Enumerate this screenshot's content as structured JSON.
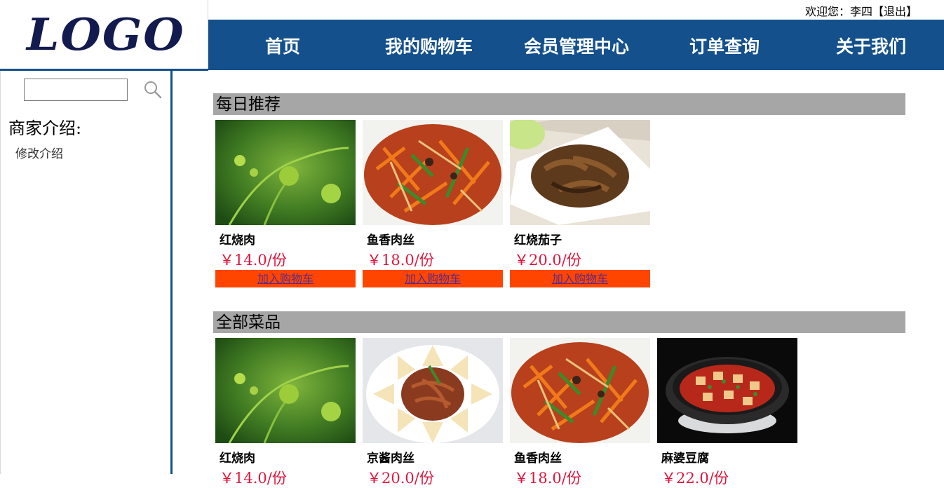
{
  "header": {
    "welcome_prefix": "欢迎您：",
    "user_name": "李四",
    "logout_label": "【退出】",
    "logo_text": "LOGO"
  },
  "nav": {
    "items": [
      {
        "label": "首页"
      },
      {
        "label": "我的购物车"
      },
      {
        "label": "会员管理中心"
      },
      {
        "label": "订单查询"
      },
      {
        "label": "关于我们"
      }
    ]
  },
  "sidebar": {
    "search_value": "",
    "search_icon": "search-icon",
    "merchant_title": "商家介绍:",
    "edit_label": "修改介绍"
  },
  "recommended": {
    "title": "每日推荐",
    "items": [
      {
        "name": "红烧肉",
        "price": "￥14.0/份",
        "cart_label": "加入购物车",
        "image": "green-plant-photo"
      },
      {
        "name": "鱼香肉丝",
        "price": "￥18.0/份",
        "cart_label": "加入购物车",
        "image": "shredded-pork-photo"
      },
      {
        "name": "红烧茄子",
        "price": "￥20.0/份",
        "cart_label": "加入购物车",
        "image": "braised-eggplant-photo"
      }
    ]
  },
  "all_dishes": {
    "title": "全部菜品",
    "items": [
      {
        "name": "红烧肉",
        "price": "￥14.0/份",
        "image": "green-plant-photo"
      },
      {
        "name": "京酱肉丝",
        "price": "￥20.0/份",
        "image": "jingjiang-pork-photo"
      },
      {
        "name": "鱼香肉丝",
        "price": "￥18.0/份",
        "image": "shredded-pork-photo"
      },
      {
        "name": "麻婆豆腐",
        "price": "￥22.0/份",
        "image": "mapo-tofu-photo"
      }
    ]
  },
  "colors": {
    "nav_bg": "#14508c",
    "section_bg": "#a6a6a6",
    "price": "#e0143c",
    "cart_button": "#ff4500"
  }
}
